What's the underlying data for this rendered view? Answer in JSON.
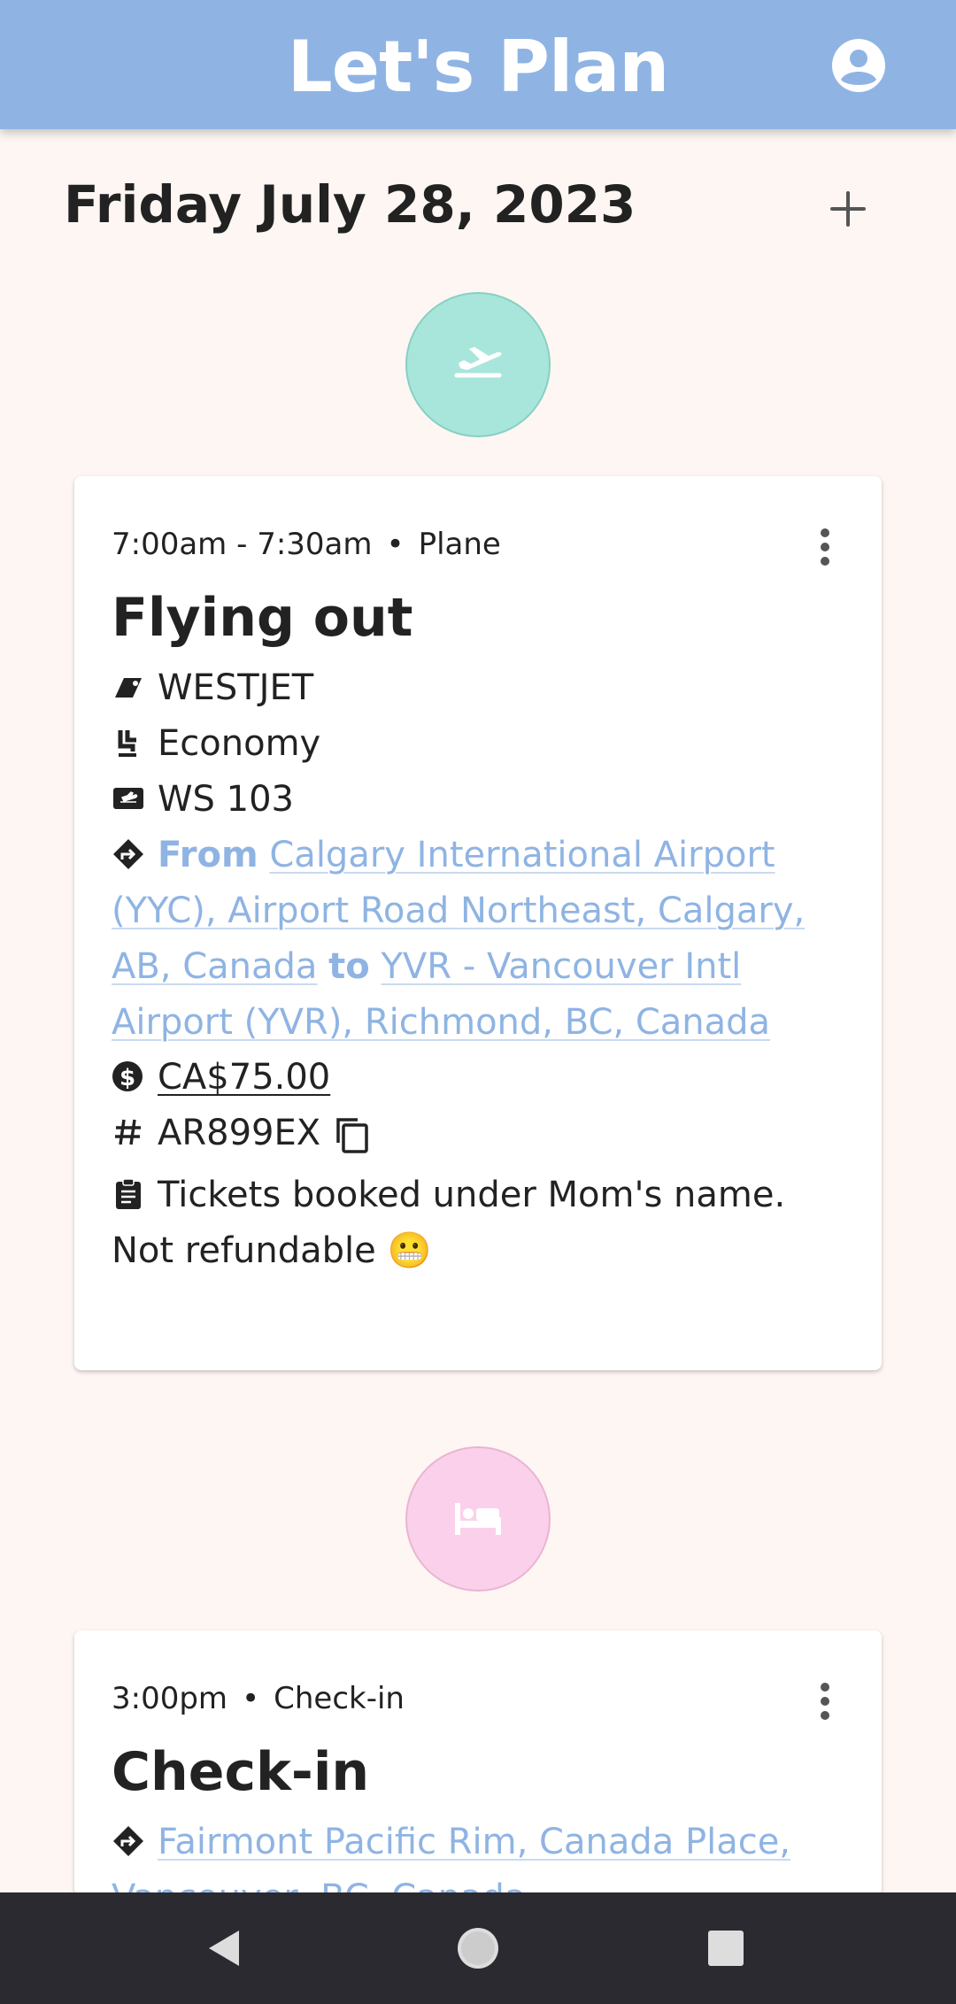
{
  "app": {
    "title": "Let's Plan"
  },
  "header": {
    "date": "Friday July 28, 2023"
  },
  "events": [
    {
      "time": "7:00am - 7:30am",
      "category": "Plane",
      "title": "Flying out",
      "airline": "WESTJET",
      "seat_class": "Economy",
      "flight_number": "WS 103",
      "route": {
        "from_label": "From",
        "from": "Calgary International Airport (YYC), Airport Road Northeast, Calgary, AB, Canada",
        "to_label": "to",
        "to": "YVR - Vancouver Intl Airport (YVR), Richmond, BC, Canada"
      },
      "price": "CA$75.00",
      "confirmation": "AR899EX",
      "notes": "Tickets booked under Mom's name. Not refundable 😬",
      "icon": "plane-takeoff-icon",
      "circle_color": "#A8E6DC"
    },
    {
      "time": "3:00pm",
      "category": "Check-in",
      "title": "Check-in",
      "location": "Fairmont Pacific Rim, Canada Place, Vancouver, BC, Canada",
      "icon": "bed-icon",
      "circle_color": "#FBD0EA"
    }
  ],
  "colors": {
    "app_bar": "#8FB4E3",
    "background": "#FDF6F2",
    "link": "#8FB4E3",
    "nav_bar": "#2A2A30"
  },
  "icons": [
    "account-circle-icon",
    "add-icon",
    "more-vert-icon",
    "tag-icon",
    "seat-icon",
    "ticket-icon",
    "directions-icon",
    "dollar-icon",
    "hash-icon",
    "copy-icon",
    "clipboard-icon",
    "back-icon",
    "home-icon",
    "recents-icon"
  ]
}
